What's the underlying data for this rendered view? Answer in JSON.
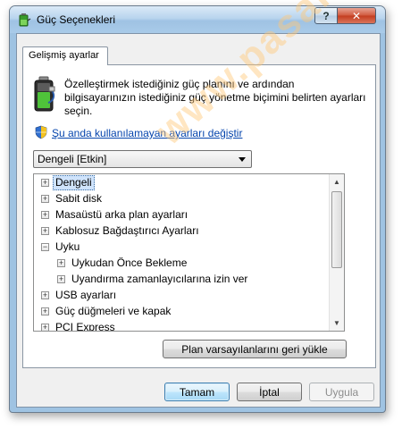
{
  "window": {
    "title": "Güç Seçenekleri",
    "help_label": "?",
    "close_label": "✕"
  },
  "tabs": [
    {
      "label": "Gelişmiş ayarlar"
    }
  ],
  "intro_text": "Özelleştirmek istediğiniz güç planını ve ardından bilgisayarınızın istediğiniz güç yönetme biçimini belirten ayarları seçin.",
  "link_text": "Şu anda kullanılamayan ayarları değiştir",
  "plan_select": {
    "value": "Dengeli [Etkin]"
  },
  "tree": [
    {
      "label": "Dengeli",
      "level": 0,
      "expander": "+",
      "selected": true
    },
    {
      "label": "Sabit disk",
      "level": 0,
      "expander": "+"
    },
    {
      "label": "Masaüstü arka plan ayarları",
      "level": 0,
      "expander": "+"
    },
    {
      "label": "Kablosuz Bağdaştırıcı Ayarları",
      "level": 0,
      "expander": "+"
    },
    {
      "label": "Uyku",
      "level": 0,
      "expander": "−"
    },
    {
      "label": "Uykudan Önce Bekleme",
      "level": 1,
      "expander": "+"
    },
    {
      "label": "Uyandırma zamanlayıcılarına izin ver",
      "level": 1,
      "expander": "+"
    },
    {
      "label": "USB ayarları",
      "level": 0,
      "expander": "+"
    },
    {
      "label": "Güç düğmeleri ve kapak",
      "level": 0,
      "expander": "+"
    },
    {
      "label": "PCI Express",
      "level": 0,
      "expander": "+"
    }
  ],
  "scroll": {
    "up_label": "▲",
    "down_label": "▼"
  },
  "buttons": {
    "restore": "Plan varsayılanlarını geri yükle",
    "ok": "Tamam",
    "cancel": "İptal",
    "apply": "Uygula"
  },
  "watermark_text": "www.pasaran",
  "colors": {
    "link": "#0645ad",
    "selection": "#cfe3fb",
    "close": "#c33c1f"
  },
  "icons": {
    "title": "battery-plug-icon",
    "intro": "battery-icon",
    "shield": "uac-shield-icon"
  }
}
